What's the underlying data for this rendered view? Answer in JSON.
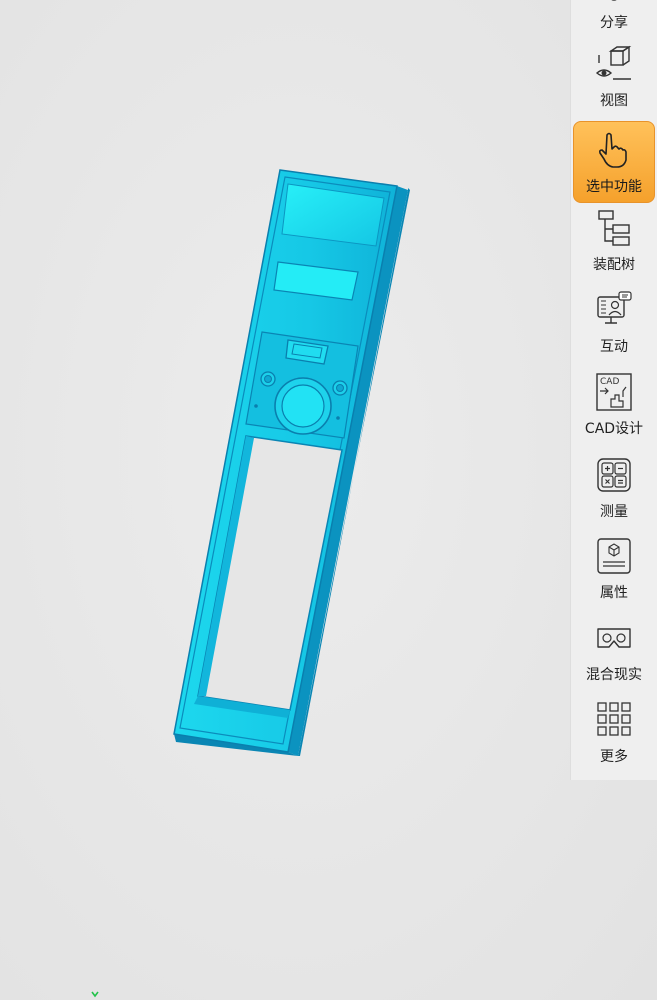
{
  "toolbar": {
    "items": [
      {
        "label": "分享",
        "icon": "share-icon"
      },
      {
        "label": "视图",
        "icon": "view-cube-icon"
      },
      {
        "label": "选中功能",
        "icon": "select-hand-icon",
        "active": true
      },
      {
        "label": "装配树",
        "icon": "assembly-tree-icon"
      },
      {
        "label": "互动",
        "icon": "interact-icon"
      },
      {
        "label": "CAD设计",
        "icon": "cad-design-icon"
      },
      {
        "label": "测量",
        "icon": "measure-icon"
      },
      {
        "label": "属性",
        "icon": "properties-icon"
      },
      {
        "label": "混合现实",
        "icon": "mixed-reality-icon"
      },
      {
        "label": "更多",
        "icon": "more-grid-icon"
      }
    ],
    "cad_icon_text": "CAD"
  },
  "colors": {
    "model": "#18d2e8",
    "model_shade": "#0c9fc8",
    "active_bg": "#f7a935",
    "toolbar_bg": "#efefef"
  }
}
